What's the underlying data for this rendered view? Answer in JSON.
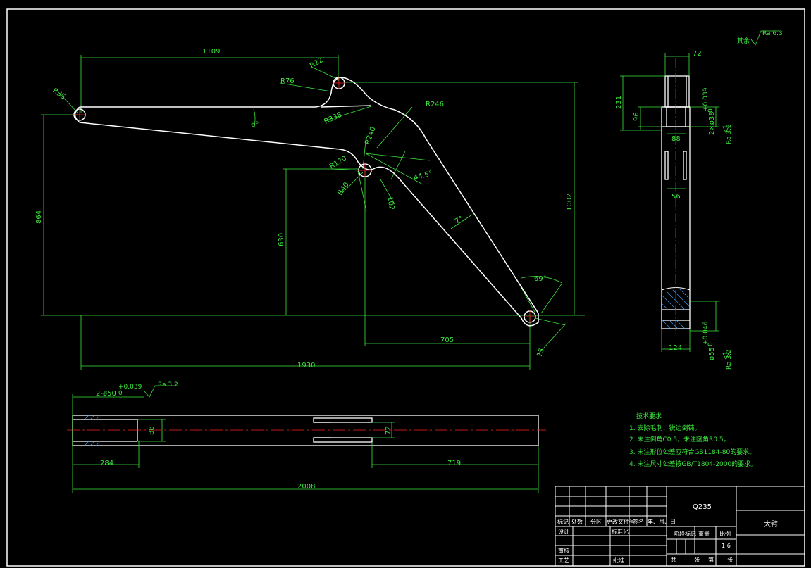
{
  "drawing": {
    "colors": {
      "background": "#000000",
      "outline": "#ffffff",
      "dimension": "#3ce63c",
      "centerline": "#ff2020",
      "hatch": "#3ca0ff"
    },
    "front_view": {
      "dims": {
        "d1109": "1109",
        "r22": "R22",
        "r76": "R76",
        "r35": "R35",
        "r338": "R338",
        "r246": "R246",
        "ang6": "6°",
        "r240": "R240",
        "r120": "R120",
        "r40": "R40",
        "ang44": "44.5°",
        "d102": "102",
        "d864": "864",
        "d630": "630",
        "d1002": "1002",
        "ang7": "7°",
        "ang69": "69°",
        "d705": "705",
        "d75": "75",
        "d1930": "1930"
      }
    },
    "side_view": {
      "dims": {
        "d72": "72",
        "d231": "231",
        "d96": "96",
        "d88": "88",
        "bore": "2×ø38",
        "bore_tol_top": "+0.039",
        "bore_tol_bot": "0",
        "d56": "56",
        "d124": "124",
        "bore2": "ø55",
        "bore2_tol_top": "+0.046",
        "bore2_tol_bot": "0",
        "ra1": "Ra 3.2",
        "ra2": "Ra 3.2"
      }
    },
    "bottom_view": {
      "dims": {
        "bore": "2-ø50",
        "tol_top": "+0.039",
        "tol_bot": "0",
        "ra": "Ra 3.2",
        "d88": "88",
        "d72": "72",
        "d284": "284",
        "d719": "719",
        "d2008": "2008"
      }
    },
    "surface_roughness": {
      "label": "其余",
      "value": "Ra 6.3"
    },
    "tech_requirements": {
      "title": "技术要求",
      "items": [
        "1. 去除毛刺、锐边倒钝。",
        "2. 未注倒角C0.5，未注圆角R0.5。",
        "3. 未注形位公差应符合GB1184-80的要求。",
        "4. 未注尺寸公差按GB/T1804-2000的要求。"
      ]
    },
    "title_block": {
      "material": "Q235",
      "part_name": "大臂",
      "header_cells": [
        "标记",
        "处数",
        "分区",
        "更改文件号",
        "签名",
        "年、月、日"
      ],
      "design": "设计",
      "standardization": "标准化",
      "review": "审核",
      "process": "工艺",
      "approve": "批准",
      "stage_mark": "阶段标记",
      "weight": "重量",
      "scale_label": "比例",
      "scale": "1:6",
      "sheets_total": "共",
      "sheets_num": "张",
      "sheet_of": "第",
      "sheet_num": "张"
    }
  }
}
